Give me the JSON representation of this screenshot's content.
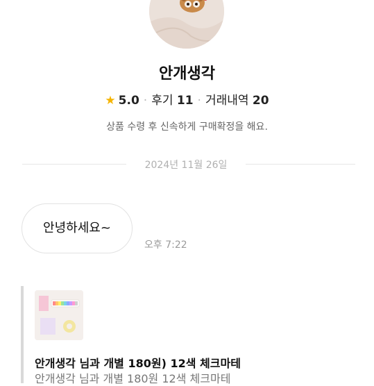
{
  "profile": {
    "nickname": "안개생각",
    "rating": "5.0",
    "reviews_label": "후기",
    "reviews_count": "11",
    "trades_label": "거래내역",
    "trades_count": "20",
    "description": "상품 수령 후 신속하게 구매확정을 해요.",
    "star_icon": "star-icon"
  },
  "chat": {
    "date_divider": "2024년 11월 26일",
    "messages": [
      {
        "text": "안녕하세요~",
        "time": "오후 7:22"
      }
    ]
  },
  "product_card": {
    "title": "안개생각 님과 개별 180원) 12색 체크마테",
    "subtitle": "안개생각 님과 개별 180원 12색 체크마테"
  },
  "colors": {
    "star": "#f5b400",
    "divider": "#e6e6e6",
    "card_bar": "#d9d9d9"
  }
}
